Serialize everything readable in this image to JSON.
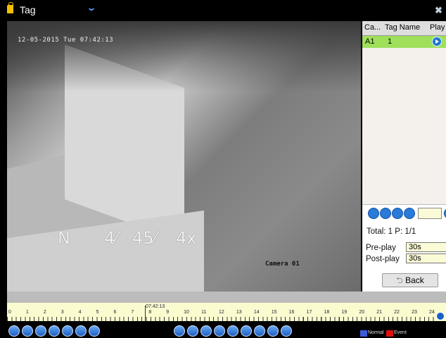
{
  "titlebar": {
    "title": "Tag"
  },
  "video": {
    "timestamp": "12-05-2015 Tue 07:42:13",
    "camera_label": "Camera 01",
    "overlay_texts": [
      "N",
      "4⁄",
      "45⁄",
      "4x"
    ]
  },
  "tag_table": {
    "headers": [
      "Ca...",
      "Tag Name",
      "Play"
    ],
    "rows": [
      {
        "camera": "A1",
        "tag_name": "1"
      }
    ]
  },
  "summary": {
    "total_text": "Total: 1  P: 1/1"
  },
  "preplay": {
    "label": "Pre-play",
    "value": "30s"
  },
  "postplay": {
    "label": "Post-play",
    "value": "30s"
  },
  "back_button": {
    "label": "Back"
  },
  "timeline": {
    "cursor_time": "07:42:13",
    "hours": [
      "0",
      "1",
      "2",
      "3",
      "4",
      "5",
      "6",
      "7",
      "8",
      "9",
      "10",
      "11",
      "12",
      "13",
      "14",
      "15",
      "16",
      "17",
      "18",
      "19",
      "20",
      "21",
      "22",
      "23",
      "24"
    ]
  },
  "legend": {
    "normal": {
      "label": "Normal",
      "color": "#3b5bd9"
    },
    "event": {
      "label": "Event",
      "color": "#e01010"
    }
  }
}
